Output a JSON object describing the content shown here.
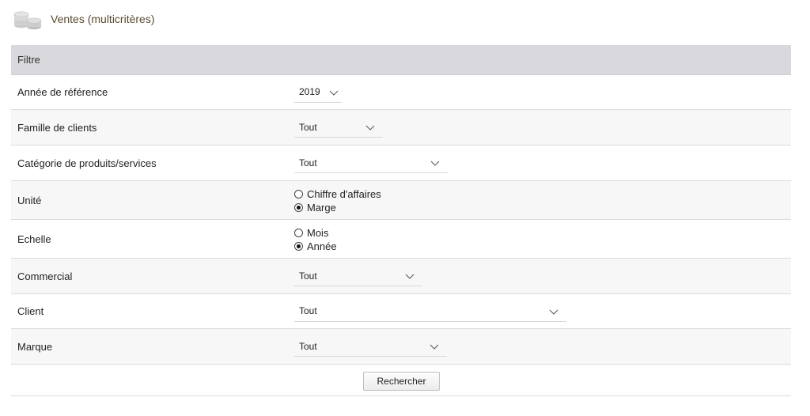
{
  "header": {
    "title": "Ventes (multicritères)",
    "icon": "coins-icon"
  },
  "filter": {
    "title": "Filtre",
    "rows": [
      {
        "label": "Année de référence",
        "type": "select",
        "value": "2019"
      },
      {
        "label": "Famille de clients",
        "type": "select",
        "value": "Tout"
      },
      {
        "label": "Catégorie de produits/services",
        "type": "select",
        "value": "Tout"
      },
      {
        "label": "Unité",
        "type": "radio",
        "options": [
          {
            "label": "Chiffre d'affaires",
            "checked": false
          },
          {
            "label": "Marge",
            "checked": true
          }
        ]
      },
      {
        "label": "Echelle",
        "type": "radio",
        "options": [
          {
            "label": "Mois",
            "checked": false
          },
          {
            "label": "Année",
            "checked": true
          }
        ]
      },
      {
        "label": "Commercial",
        "type": "select",
        "value": "Tout"
      },
      {
        "label": "Client",
        "type": "select",
        "value": "Tout"
      },
      {
        "label": "Marque",
        "type": "select",
        "value": "Tout"
      }
    ]
  },
  "actions": {
    "search_label": "Rechercher"
  }
}
